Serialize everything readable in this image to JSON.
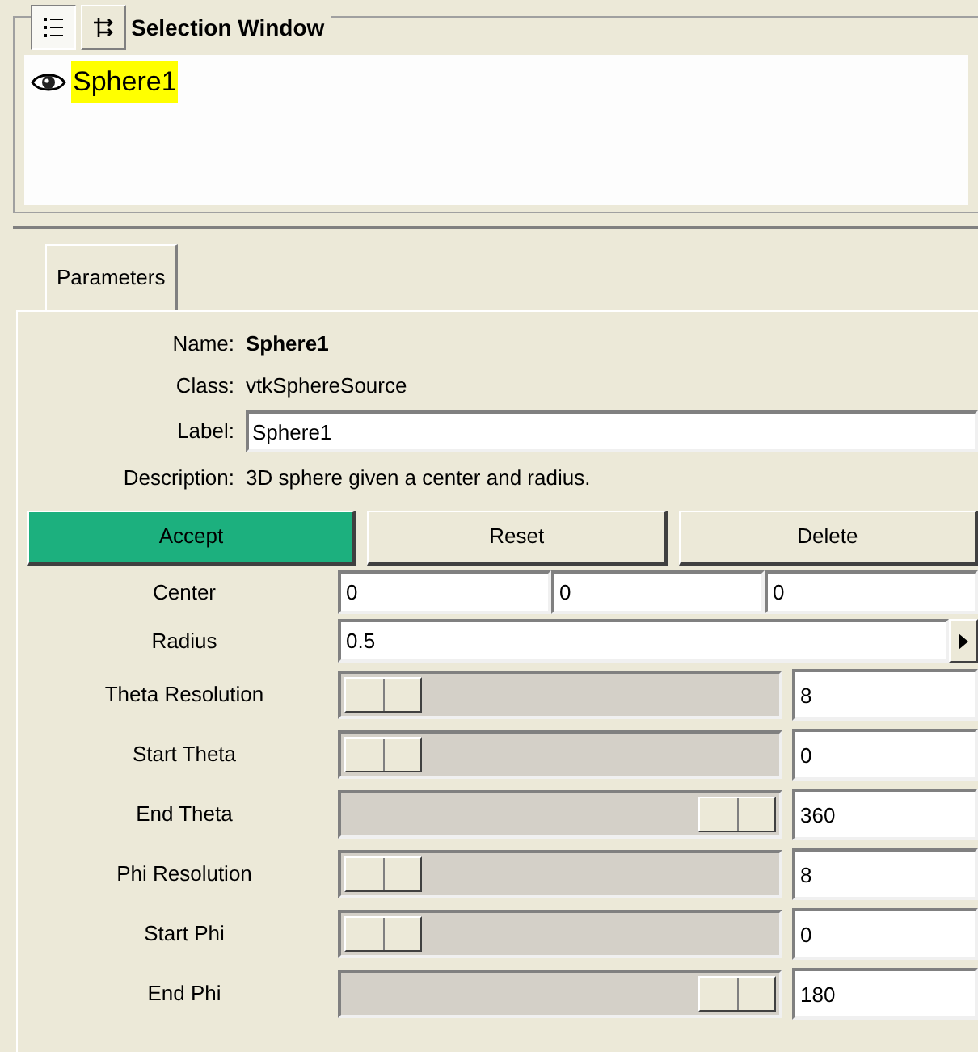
{
  "selection_window": {
    "title": "Selection Window",
    "toolbar": [
      {
        "kind": "list",
        "selected": true
      },
      {
        "kind": "branch",
        "selected": false
      }
    ],
    "items": [
      {
        "label": "Sphere1",
        "visible": true,
        "selected": true
      }
    ]
  },
  "tabs": [
    {
      "label": "Parameters",
      "selected": true
    }
  ],
  "info": [
    {
      "label": "Name:",
      "value": "Sphere1",
      "kind": "bold"
    },
    {
      "label": "Class:",
      "value": "vtkSphereSource",
      "kind": "text"
    },
    {
      "label": "Label:",
      "value": "Sphere1",
      "kind": "field"
    },
    {
      "label": "Description:",
      "value": "3D sphere given a center and radius.",
      "kind": "text"
    }
  ],
  "buttons": [
    {
      "label": "Accept",
      "highlighted": true
    },
    {
      "label": "Reset",
      "highlighted": false
    },
    {
      "label": "Delete",
      "highlighted": false
    }
  ],
  "parameters": [
    {
      "label": "Center",
      "kind": "vector",
      "values": [
        "0",
        "0",
        "0"
      ]
    },
    {
      "label": "Radius",
      "kind": "entry",
      "value": "0.5"
    },
    {
      "label": "Theta Resolution",
      "kind": "slider",
      "level": 0,
      "value": "8"
    },
    {
      "label": "Start Theta",
      "kind": "slider",
      "level": 0,
      "value": "0"
    },
    {
      "label": "End Theta",
      "kind": "slider",
      "level": 1,
      "value": "360"
    },
    {
      "label": "Phi Resolution",
      "kind": "slider",
      "level": 0,
      "value": "8"
    },
    {
      "label": "Start Phi",
      "kind": "slider",
      "level": 0,
      "value": "0"
    },
    {
      "label": "End Phi",
      "kind": "slider",
      "level": 1,
      "value": "180"
    }
  ]
}
